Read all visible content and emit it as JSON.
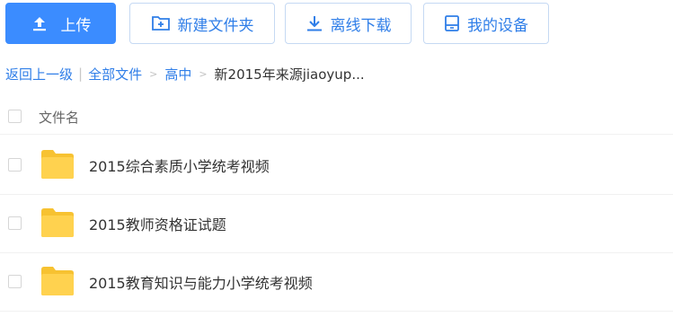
{
  "toolbar": {
    "upload_label": "上传",
    "new_folder_label": "新建文件夹",
    "offline_download_label": "离线下载",
    "my_device_label": "我的设备"
  },
  "breadcrumb": {
    "back": "返回上一级",
    "separator": "|",
    "all_files": "全部文件",
    "arrow": ">",
    "level1": "高中",
    "current": "新2015年来源jiaoyup..."
  },
  "list": {
    "column_name": "文件名",
    "items": [
      {
        "name": "2015综合素质小学统考视频"
      },
      {
        "name": "2015教师资格证试题"
      },
      {
        "name": "2015教育知识与能力小学统考视频"
      }
    ]
  },
  "colors": {
    "primary": "#3b8cff",
    "link": "#2f7ee8",
    "folder": "#ffd24f"
  }
}
